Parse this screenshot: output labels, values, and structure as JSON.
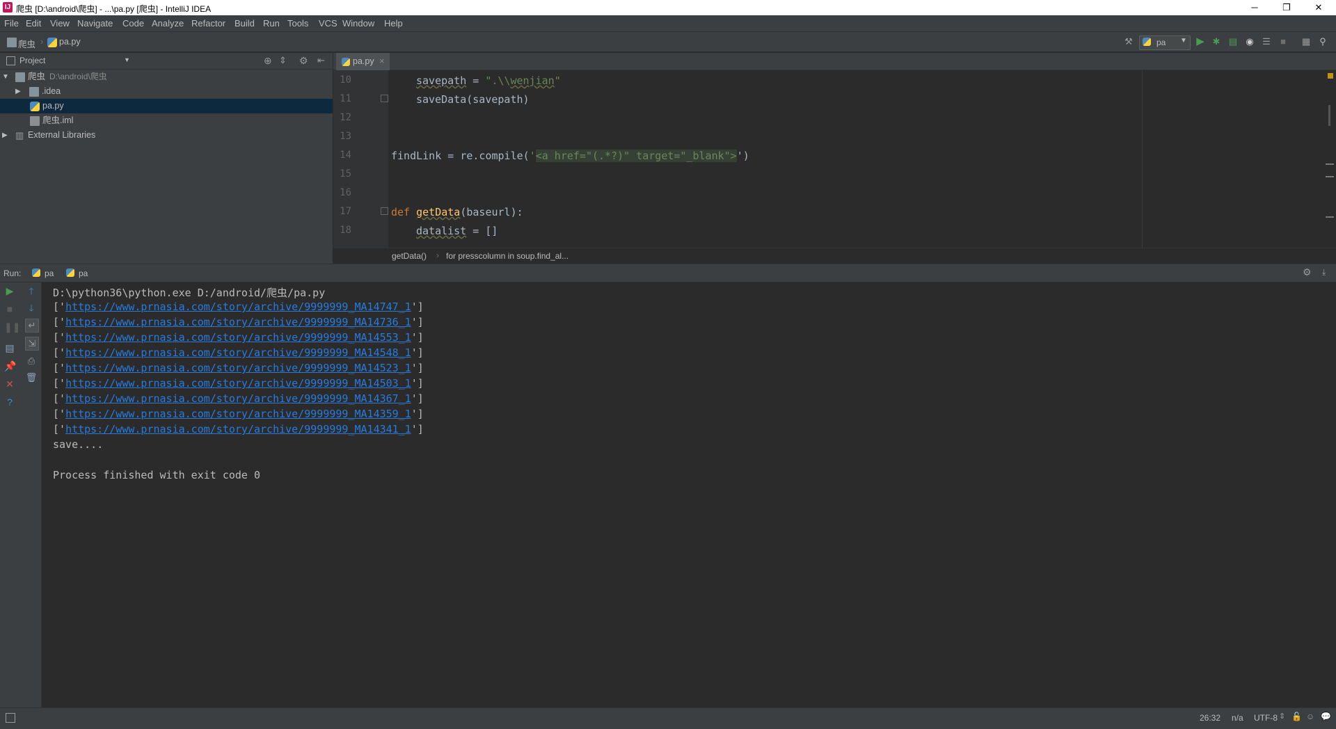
{
  "window": {
    "app_icon": "IJ",
    "title": "爬虫 [D:\\android\\爬虫] - ...\\pa.py [爬虫] - IntelliJ IDEA",
    "controls": [
      "─",
      "❐",
      "✕"
    ]
  },
  "menu": [
    "File",
    "Edit",
    "View",
    "Navigate",
    "Code",
    "Analyze",
    "Refactor",
    "Build",
    "Run",
    "Tools",
    "VCS",
    "Window",
    "Help"
  ],
  "navbar": {
    "crumbs": [
      "爬虫",
      "pa.py"
    ],
    "run_config": "pa"
  },
  "project": {
    "header": "Project",
    "tree": [
      {
        "arrow": "▼",
        "label": "爬虫",
        "path": "D:\\android\\爬虫"
      },
      {
        "arrow": "▶",
        "label": ".idea"
      },
      {
        "label": "pa.py"
      },
      {
        "label": "爬虫.iml"
      },
      {
        "arrow": "▶",
        "label": "External Libraries"
      }
    ]
  },
  "editor": {
    "tab": "pa.py",
    "tab_close": "×",
    "line_numbers": [
      "10",
      "11",
      "12",
      "13",
      "14",
      "15",
      "16",
      "17",
      "18"
    ],
    "code": {
      "l10_var": "savepath",
      "l10_op": " = ",
      "l10_str_a": "\".\\\\",
      "l10_str_b": "wenjian",
      "l10_str_c": "\"",
      "l11": "saveData(savepath)",
      "l14_a": "findLink = re.compile(",
      "l14_q": "'",
      "l14_str": "<a href=\"(.*?)\" target=\"_blank\">",
      "l14_b": "')",
      "l17_kw": "def ",
      "l17_fn": "getData",
      "l17_rest": "(baseurl):",
      "l18_var": "datalist",
      "l18_rest": " = []"
    },
    "breadcrumb": [
      "getData()",
      "for presscolumn in soup.find_al..."
    ]
  },
  "run": {
    "label": "Run:",
    "tabs": [
      "pa",
      "pa"
    ],
    "command": "D:\\python36\\python.exe D:/android/爬虫/pa.py",
    "links": [
      "https://www.prnasia.com/story/archive/9999999_MA14747_1",
      "https://www.prnasia.com/story/archive/9999999_MA14736_1",
      "https://www.prnasia.com/story/archive/9999999_MA14553_1",
      "https://www.prnasia.com/story/archive/9999999_MA14548_1",
      "https://www.prnasia.com/story/archive/9999999_MA14523_1",
      "https://www.prnasia.com/story/archive/9999999_MA14503_1",
      "https://www.prnasia.com/story/archive/9999999_MA14367_1",
      "https://www.prnasia.com/story/archive/9999999_MA14359_1",
      "https://www.prnasia.com/story/archive/9999999_MA14341_1"
    ],
    "open_bracket": "['",
    "close_bracket": "']",
    "save_line": "save....",
    "exit_line": "Process finished with exit code 0"
  },
  "status": {
    "position": "26:32",
    "line_sep": "n/a",
    "encoding": "UTF-8"
  },
  "colors": {
    "background": "#2b2b2b",
    "panel": "#3c3f41",
    "link": "#287bde",
    "keyword": "#cc7832",
    "string": "#6a8759",
    "function": "#ffc66d",
    "run_green": "#499c54"
  }
}
